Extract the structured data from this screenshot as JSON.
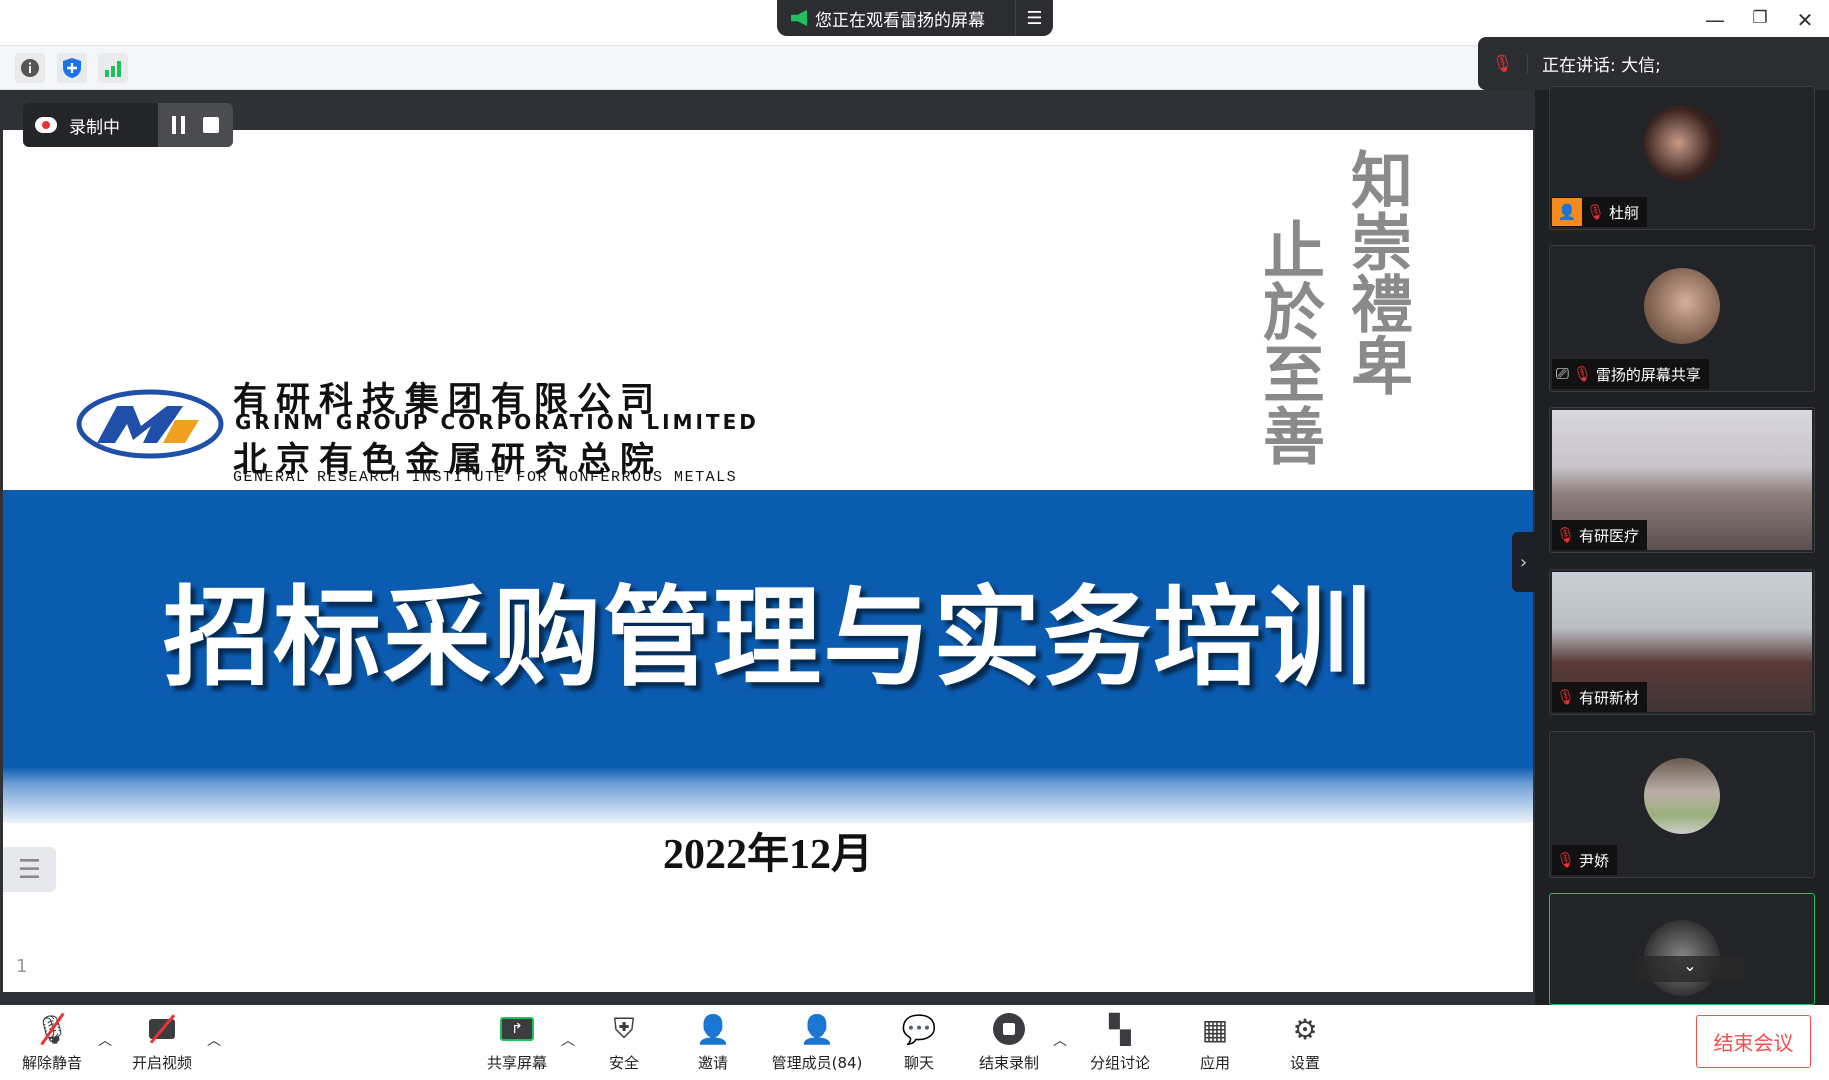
{
  "banner": {
    "text": "您正在观看雷扬的屏幕",
    "menu_icon": "list-icon"
  },
  "window": {
    "minimize": "—",
    "restore": "❐",
    "close": "✕"
  },
  "recording": {
    "label": "录制中"
  },
  "speaking": {
    "text": "正在讲话: 大信;"
  },
  "slide": {
    "company_cn": "有研科技集团有限公司",
    "company_en": "GRINM GROUP CORPORATION LIMITED",
    "institute_cn": "北京有色金属研究总院",
    "institute_en": "GENERAL RESEARCH INSTITUTE FOR NONFERROUS METALS",
    "calligraphy_right": "知崇禮卑",
    "calligraphy_left": "止於至善",
    "title": "招标采购管理与实务培训",
    "date": "2022年12月",
    "page_number": "1",
    "colors": {
      "band": "#0b5cb1",
      "logo_blue": "#1f4fa8",
      "logo_orange": "#f0a020"
    }
  },
  "participants": [
    {
      "name": "杜舸",
      "muted": true
    },
    {
      "name": "雷扬的屏幕共享",
      "muted": true
    },
    {
      "name": "有研医疗",
      "muted": true
    },
    {
      "name": "有研新材",
      "muted": true
    },
    {
      "name": "尹娇",
      "muted": true
    },
    {
      "name": "",
      "muted": false
    }
  ],
  "toolbar": {
    "unmute": "解除静音",
    "video": "开启视频",
    "share": "共享屏幕",
    "security": "安全",
    "invite": "邀请",
    "participants": "管理成员(84)",
    "chat": "聊天",
    "stop_record": "结束录制",
    "breakout": "分组讨论",
    "apps": "应用",
    "settings": "设置",
    "end": "结束会议"
  },
  "colors": {
    "end_button": "#f05050",
    "share_green": "#1fc25a",
    "active_speaker_border": "#1fc25a"
  }
}
